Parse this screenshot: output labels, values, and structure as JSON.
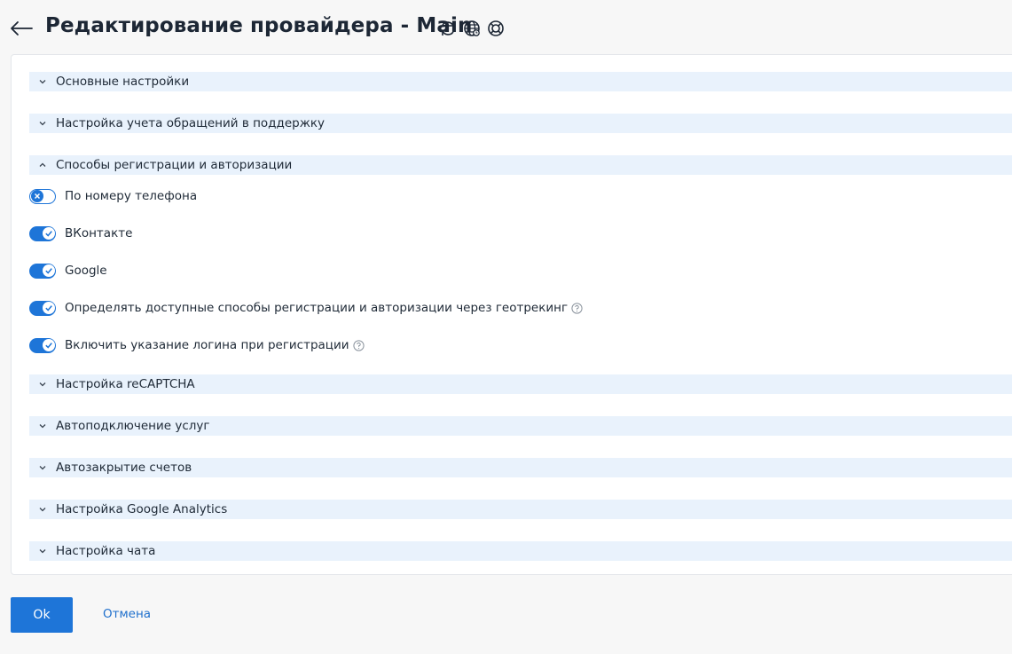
{
  "header": {
    "title": "Редактирование провайдера - Main",
    "icons": [
      "back-arrow-icon",
      "refresh-icon",
      "globe-icon",
      "support-icon"
    ]
  },
  "sections": {
    "main_settings": "Основные настройки",
    "support_tracking": "Настройка учета обращений в поддержку",
    "auth_methods": "Способы регистрации и авторизации",
    "recaptcha": "Настройка reCAPTCHA",
    "auto_services": "Автоподключение услуг",
    "auto_close": "Автозакрытие счетов",
    "google_analytics": "Настройка Google Analytics",
    "chat": "Настройка чата"
  },
  "toggles": [
    {
      "label": "По номеру телефона",
      "checked": false
    },
    {
      "label": "ВКонтакте",
      "checked": true
    },
    {
      "label": "Google",
      "checked": true
    },
    {
      "label": "Определять доступные способы регистрации и авторизации через геотрекинг",
      "checked": true,
      "help": true
    },
    {
      "label": "Включить указание логина при регистрации",
      "checked": true,
      "help": true
    }
  ],
  "footer": {
    "ok_label": "Ok",
    "cancel_label": "Отмена"
  },
  "colors": {
    "accent": "#1e75d8",
    "section_bg": "#e9f2fc",
    "page_bg": "#f7f7f7"
  }
}
